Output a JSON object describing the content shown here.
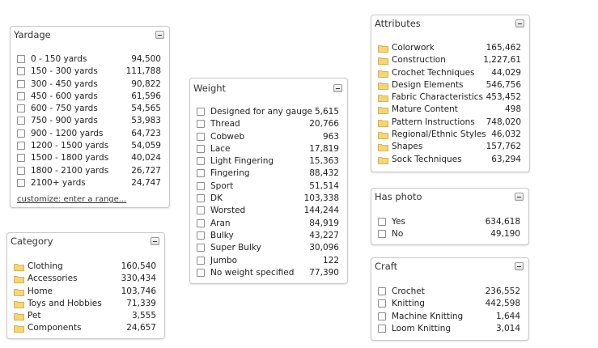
{
  "yardage": {
    "title": "Yardage",
    "items": [
      {
        "label": "0 - 150 yards",
        "count": "94,500"
      },
      {
        "label": "150 - 300 yards",
        "count": "111,788"
      },
      {
        "label": "300 - 450 yards",
        "count": "90,822"
      },
      {
        "label": "450 - 600 yards",
        "count": "61,596"
      },
      {
        "label": "600 - 750 yards",
        "count": "54,565"
      },
      {
        "label": "750 - 900 yards",
        "count": "53,983"
      },
      {
        "label": "900 - 1200 yards",
        "count": "64,723"
      },
      {
        "label": "1200 - 1500 yards",
        "count": "54,059"
      },
      {
        "label": "1500 - 1800 yards",
        "count": "40,024"
      },
      {
        "label": "1800 - 2100 yards",
        "count": "26,727"
      },
      {
        "label": "2100+ yards",
        "count": "24,747"
      }
    ],
    "customize_link": "customize: enter a range..."
  },
  "category": {
    "title": "Category",
    "items": [
      {
        "label": "Clothing",
        "count": "160,540"
      },
      {
        "label": "Accessories",
        "count": "330,434"
      },
      {
        "label": "Home",
        "count": "103,746"
      },
      {
        "label": "Toys and Hobbies",
        "count": "71,339"
      },
      {
        "label": "Pet",
        "count": "3,555"
      },
      {
        "label": "Components",
        "count": "24,657"
      }
    ]
  },
  "weight": {
    "title": "Weight",
    "items": [
      {
        "label": "Designed for any gauge",
        "count": "5,615"
      },
      {
        "label": "Thread",
        "count": "20,766"
      },
      {
        "label": "Cobweb",
        "count": "963"
      },
      {
        "label": "Lace",
        "count": "17,819"
      },
      {
        "label": "Light Fingering",
        "count": "15,363"
      },
      {
        "label": "Fingering",
        "count": "88,432"
      },
      {
        "label": "Sport",
        "count": "51,514"
      },
      {
        "label": "DK",
        "count": "103,338"
      },
      {
        "label": "Worsted",
        "count": "144,244"
      },
      {
        "label": "Aran",
        "count": "84,919"
      },
      {
        "label": "Bulky",
        "count": "43,227"
      },
      {
        "label": "Super Bulky",
        "count": "30,096"
      },
      {
        "label": "Jumbo",
        "count": "122"
      },
      {
        "label": "No weight specified",
        "count": "77,390"
      }
    ]
  },
  "attributes": {
    "title": "Attributes",
    "items": [
      {
        "label": "Colorwork",
        "count": "165,462"
      },
      {
        "label": "Construction",
        "count": "1,227,61"
      },
      {
        "label": "Crochet Techniques",
        "count": "44,029"
      },
      {
        "label": "Design Elements",
        "count": "546,756"
      },
      {
        "label": "Fabric Characteristics",
        "count": "453,452"
      },
      {
        "label": "Mature Content",
        "count": "498"
      },
      {
        "label": "Pattern Instructions",
        "count": "748,020"
      },
      {
        "label": "Regional/Ethnic Styles",
        "count": "46,032"
      },
      {
        "label": "Shapes",
        "count": "157,762"
      },
      {
        "label": "Sock Techniques",
        "count": "63,294"
      }
    ]
  },
  "has_photo": {
    "title": "Has photo",
    "items": [
      {
        "label": "Yes",
        "count": "634,618"
      },
      {
        "label": "No",
        "count": "49,190"
      }
    ]
  },
  "craft": {
    "title": "Craft",
    "items": [
      {
        "label": "Crochet",
        "count": "236,552"
      },
      {
        "label": "Knitting",
        "count": "442,598"
      },
      {
        "label": "Machine Knitting",
        "count": "1,644"
      },
      {
        "label": "Loom Knitting",
        "count": "3,014"
      }
    ]
  },
  "icons": {
    "collapse": "collapse-minus-icon",
    "checkbox": "checkbox-icon",
    "folder": "folder-icon"
  },
  "colors": {
    "folder_fill": "#f5d57a",
    "folder_stroke": "#c9a23b",
    "panel_border": "#c9c9c9"
  }
}
